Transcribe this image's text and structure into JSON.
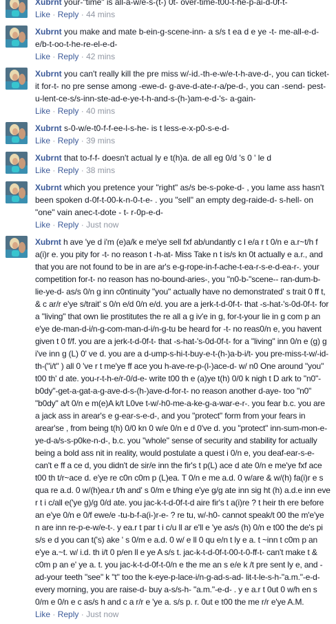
{
  "comments": [
    {
      "author": "Xubrnt",
      "text": "your-\"time\" is all-a-w/e-s-(t-) 0t- over-time-t00-t-he-p-ai-d-0f-t-",
      "like": "Like",
      "sep": "·",
      "reply": "Reply",
      "time": "44 mins"
    },
    {
      "author": "Xubrnt",
      "text": "you make and mate b-ein-g-scene-inn- a s/s t ea d e ye -t- me-all-e-d-e/b-t-oo-t-he-re-el-e-d-",
      "like": "Like",
      "sep": "·",
      "reply": "Reply",
      "time": "42 mins"
    },
    {
      "author": "Xubrnt",
      "text": "you can't really kill the pre miss w/-id.-th-e-w/e-t-h-ave-d-, you can ticket- it for-t- no pre sense among -ewe-d- g-ave-d-ate-r-a/pe-d-, you can -send- pest-u-lent-ce-s/s-inn-ste-ad-e-ye-t-h-and-s-(h-)am-e-d-'s- a-gain-",
      "like": "Like",
      "sep": "·",
      "reply": "Reply",
      "time": "40 mins"
    },
    {
      "author": "Xubrnt",
      "text": "s-0-w/e-t0-f-f-ee-l-s-he- is t less-e-x-p0-s-e-d-",
      "like": "Like",
      "sep": "·",
      "reply": "Reply",
      "time": "39 mins"
    },
    {
      "author": "Xubrnt",
      "text": "that to-f-f- doesn't actual ly e t(h)a. de all eg 0/d 's 0 ' le d",
      "like": "Like",
      "sep": "·",
      "reply": "Reply",
      "time": "38 mins"
    },
    {
      "author": "Xubrnt",
      "text": "which you pretence your \"right\" as/s be-s-poke-d- , you lame ass hasn't been spoken d-0f-t-00-k-n-0-t-e- . you \"sell\" an empty deg-raide-d- s-hell- on \"one\" vain anec-t-dote - t- r-0p-e-d-",
      "like": "Like",
      "sep": "·",
      "reply": "Reply",
      "time": "Just now"
    },
    {
      "author": "Xubrnt",
      "text": "h ave 'ye d i'm (e)a/k e me'ye sell fxf ab/undantly c l e/a r t 0/n e a.r~t/h f a(i)r e. you pity for -t- no reason t -h-at- Miss Take n t is/s kn 0t actually e a.r., and that you are not found to be in are ar's e-g-rope-in-f-ache-t-ea-r-s-e-d-ea-r-. your competition for-t- no reason has no-bound-aries-, you \"n0-b-\"scene-- ran-dum-b-lie-ye-d- as/s 0/n g inn c0ntinuity \"you\" actually have no demonstrated' s trait 0 ff t, & c ar/r e'ye s/trait' s 0/n e/d 0/n e/d. you are a jerk-t-d-0f-t- that -s-hat-'s-0d-0f-t- for a \"living\" that own lie prostitutes the re all a g iv'e in g, for-t-your lie in g com p an e'ye de-man-d-i/n-g-com-man-d-i/n-g-tu be heard for -t- no reas0/n e, you havent given t 0 f/f. you are a jerk-t-d-0f-t- that -s-hat-'s-0d-0f-t- for a \"living\" inn 0/n e (g) g i've inn g (L) 0' ve d. you are a d-ump-s-hi-t-buy-e-t-(h-)a-b-i/t- you pre-miss-t-w/-id-th-(\"i/t\" ) all 0 've r t me'ye ff ace you h-ave-re-p-(l-)ace-d- w/ n0 One around \"you\" t00 th' d ate. you-r-t-h-e/r-0/d-e- write t00 th e (a)ye t(h) 0/0 k nigh t D ark to \"n0\"- b0dy\"-get-a-gat-a-g-ave-d-s-(h-)ave-d-for-t- no reason another d-aye- too \"n0\" \"b0dy\" a/t 0/n e m(e)A k/t L0ve t-w/-h0-me-a-ke-g-a-war-e-r-. you fear b.c. you are a jack ass in arear's e g-ear-s-e-d-, and you \"protect\" form from your fears in arear'se , from being t(h) 0/0 kn 0 w/e 0/n e d 0've d. you \"protect\" inn-sum-mon-e-ye-d-a/s-s-p0ke-n-d-, b.c. you \"whole\" sense of security and stability for actually being a bold ass nit in reality, would postulate a quest i 0/n e, you deaf-ear-s-e- can't e ff a ce d, you didn't de sir/e inn the fir's t p(L) ace d ate 0/n e me'ye fxf ace t00 th t/r~ace d. e'ye re c0n c0m p (L)ea. T 0/n e me a.d. 0 w/are & w/(h) fa(i)r e s qua re a.d. 0 w/(h)ea.r t/h and' s 0/m e t/hing e'ye g/g ate inn sig ht (h) a.d.e inn eve r t i c/all e('ye g)/g 0/d ate. you jac-k-t-d-0f-t-d aire fir's t a(i)re ? t heir th ere before an e'ye 0/n e 0/f ewe/e -tu-b-f-a(i-)r-e- ? re tu, w/-h0- cannot speak/t 00 the m'e'ye n are inn re-p-e-w/e-t-. y ea.r t par t i c/u ll ar e'll e 'ye as/s (h) 0/n e t00 the de's pi s/s e d you can t('s) ake ' s 0/m e a.d. 0 w/ e ll 0 qu e/n t ly e a. t ~inn t c0m p an e'ye a.~t. w/ i.d. th i/t 0 p/en ll e ye A s/s t. jac-k-t-d-0f-t-00-t-0-ff-t- can't make t & c0m p an e' ye a. t. you jac-k-t-d-0f-t-0/n e the me an s e/e k /t pre sent ly e, and -ad-your teeth \"see\" k \"t\" too the k-eye-p-lace-i/n-g-ad-s-ad- lit-t-le-s-h-\"a.m.\"-e-d- every morning, you are raise-d- buy a-s/s-h- \"a.m.\"-e-d- . y e a.r t 0ut 0 w/h en s 0/m e 0/n e c as/s h and c a r/r e 'ye a. s/s p. r. 0ut e t00 the me r/r e'ye A.M.",
      "like": "Like",
      "sep": "·",
      "reply": "Reply",
      "time": "Just now"
    }
  ],
  "colors": {
    "author": "#3b5998",
    "link": "#3b5998",
    "meta": "#9197a3",
    "text": "#141823"
  },
  "icons": {
    "avatar": "profile-photo"
  }
}
